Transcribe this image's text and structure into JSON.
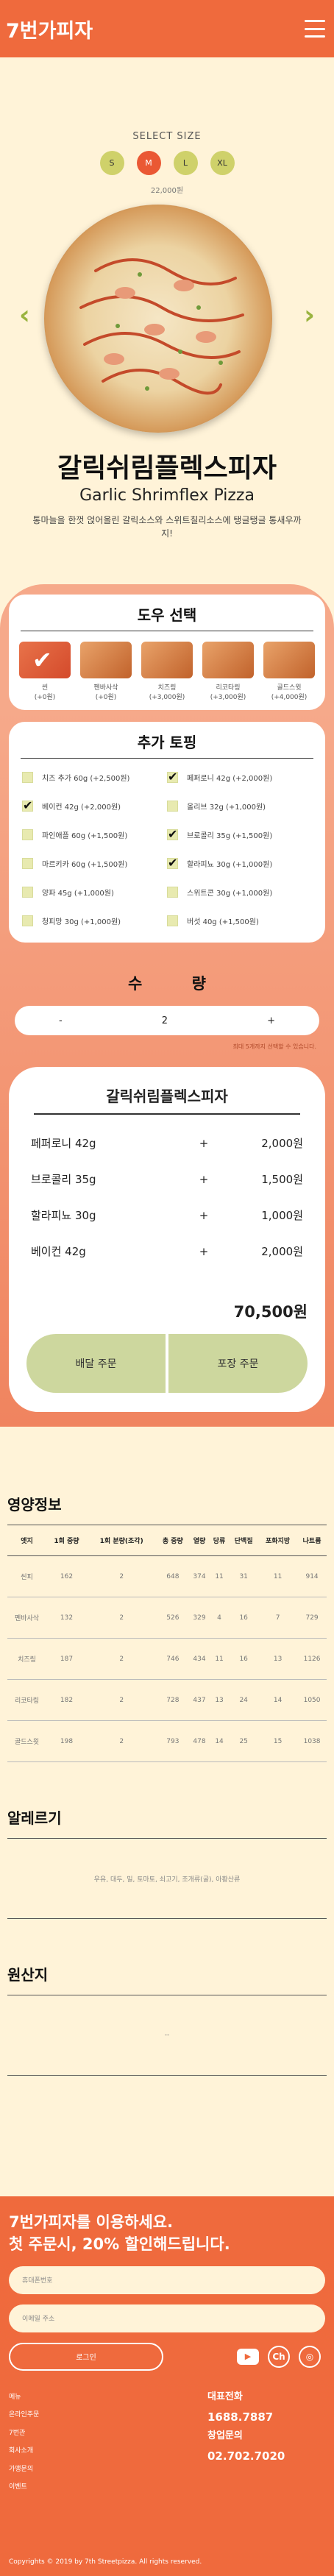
{
  "header": {
    "logo": "7번가피자",
    "menu_icon": "hamburger-menu-icon"
  },
  "size": {
    "label": "SELECT SIZE",
    "options": [
      "S",
      "M",
      "L",
      "XL"
    ],
    "selected": "M",
    "price": "22,000원"
  },
  "product": {
    "name_ko": "갈릭쉬림플렉스피자",
    "name_en": "Garlic Shrimflex Pizza",
    "desc": "통마늘을 한껏 얹어올린 갈릭소스와 스위트칠리소스에 탱글탱글 통새우까지!"
  },
  "dough": {
    "title": "도우 선택",
    "items": [
      {
        "name": "씬",
        "price": "(+0원)",
        "selected": true
      },
      {
        "name": "펜바사삭",
        "price": "(+0원)",
        "selected": false
      },
      {
        "name": "치즈링",
        "price": "(+3,000원)",
        "selected": false
      },
      {
        "name": "리코타링",
        "price": "(+3,000원)",
        "selected": false
      },
      {
        "name": "골드스윗",
        "price": "(+4,000원)",
        "selected": false
      }
    ]
  },
  "toppings": {
    "title": "추가 토핑",
    "items": [
      {
        "label": "치즈 추가 60g (+2,500원)",
        "checked": false
      },
      {
        "label": "페퍼로니 42g (+2,000원)",
        "checked": true
      },
      {
        "label": "베이컨 42g (+2,000원)",
        "checked": true
      },
      {
        "label": "올리브 32g (+1,000원)",
        "checked": false
      },
      {
        "label": "파인애플 60g (+1,500원)",
        "checked": false
      },
      {
        "label": "브로콜리 35g (+1,500원)",
        "checked": true
      },
      {
        "label": "마르키카 60g (+1,500원)",
        "checked": false
      },
      {
        "label": "할라피뇨 30g (+1,000원)",
        "checked": true
      },
      {
        "label": "양파 45g (+1,000원)",
        "checked": false
      },
      {
        "label": "스위트콘 30g (+1,000원)",
        "checked": false
      },
      {
        "label": "청피망 30g (+1,000원)",
        "checked": false
      },
      {
        "label": "버섯 40g (+1,500원)",
        "checked": false
      }
    ]
  },
  "quantity": {
    "label": "수 량",
    "minus": "-",
    "value": "2",
    "plus": "+",
    "note": "최대 5개까지 선택할 수 있습니다."
  },
  "summary": {
    "title": "갈릭쉬림플렉스피자",
    "rows": [
      {
        "name": "페퍼로니 42g",
        "plus": "+",
        "price": "2,000원"
      },
      {
        "name": "브로콜리 35g",
        "plus": "+",
        "price": "1,500원"
      },
      {
        "name": "할라피뇨 30g",
        "plus": "+",
        "price": "1,000원"
      },
      {
        "name": "베이컨 42g",
        "plus": "+",
        "price": "2,000원"
      }
    ],
    "total": "70,500원",
    "delivery_btn": "배달 주문",
    "pickup_btn": "포장 주문"
  },
  "nutrition": {
    "title": "영양정보",
    "headers": [
      "엣지",
      "1회 중량",
      "1회 분량(조각)",
      "총 중량",
      "열량",
      "당류",
      "단백질",
      "포화지방",
      "나트륨"
    ],
    "rows": [
      [
        "씬피",
        "162",
        "2",
        "648",
        "374",
        "11",
        "31",
        "11",
        "914"
      ],
      [
        "펜바사삭",
        "132",
        "2",
        "526",
        "329",
        "4",
        "16",
        "7",
        "729"
      ],
      [
        "치즈링",
        "187",
        "2",
        "746",
        "434",
        "11",
        "16",
        "13",
        "1126"
      ],
      [
        "리코타링",
        "182",
        "2",
        "728",
        "437",
        "13",
        "24",
        "14",
        "1050"
      ],
      [
        "골드스윗",
        "198",
        "2",
        "793",
        "478",
        "14",
        "25",
        "15",
        "1038"
      ]
    ]
  },
  "allergy": {
    "title": "알레르기",
    "text": "우유, 대두, 밀, 토마토, 쇠고기, 조개류(굴), 아황산류"
  },
  "origin": {
    "title": "원산지",
    "text": "--"
  },
  "footer": {
    "line1": "7번가피자를 이용하세요.",
    "line2": "첫 주문시, 20% 할인해드립니다.",
    "phone_placeholder": "휴대폰번호",
    "address_placeholder": "이메일 주소",
    "login": "로그인",
    "social": [
      "youtube-icon",
      "kakao-icon",
      "instagram-icon"
    ],
    "links": [
      "메뉴",
      "온라인주문",
      "7번관",
      "회사소개",
      "가맹문의",
      "이벤트"
    ],
    "rep_label": "대표전화",
    "rep_phone": "1688.7887",
    "fr_label": "창업문의",
    "fr_phone": "02.702.7020",
    "copyright": "Copyrights © 2019 by 7th Streetpizza. All rights reserved."
  }
}
